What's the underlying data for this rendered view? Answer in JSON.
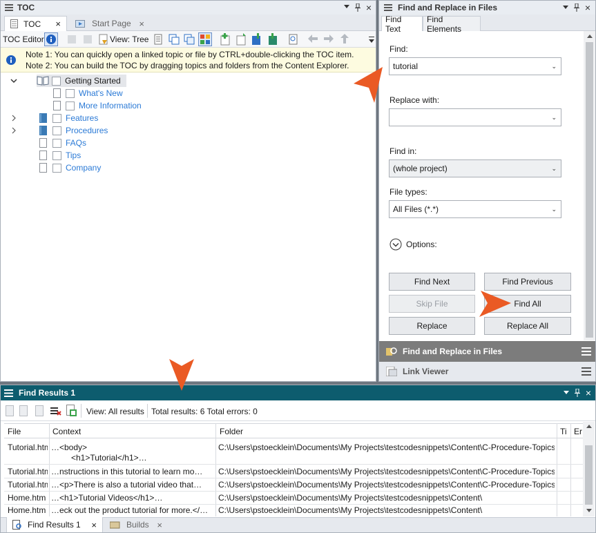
{
  "toc_pane": {
    "title": "TOC",
    "tabs": [
      {
        "label": "TOC"
      },
      {
        "label": "Start Page"
      }
    ],
    "toolbar": {
      "editor_label": "TOC Editor",
      "view_label": "View: Tree"
    },
    "notes": [
      "Note 1: You can quickly open a linked topic or file by CTRL+double-clicking the TOC item.",
      "Note 2: You can build the TOC by dragging topics and folders from the Content Explorer."
    ],
    "tree": [
      {
        "label": "Getting Started"
      },
      {
        "label": "What's New"
      },
      {
        "label": "More Information"
      },
      {
        "label": "Features"
      },
      {
        "label": "Procedures"
      },
      {
        "label": "FAQs"
      },
      {
        "label": "Tips"
      },
      {
        "label": "Company"
      }
    ]
  },
  "find_pane": {
    "title": "Find and Replace in Files",
    "tabs": [
      {
        "label": "Find Text"
      },
      {
        "label": "Find Elements"
      }
    ],
    "find_label": "Find:",
    "find_value": "tutorial",
    "replace_label": "Replace with:",
    "replace_value": "",
    "find_in_label": "Find in:",
    "find_in_value": "(whole project)",
    "file_types_label": "File types:",
    "file_types_value": "All Files (*.*)",
    "options_label": "Options:",
    "buttons": {
      "find_next": "Find Next",
      "find_previous": "Find Previous",
      "skip_file": "Skip File",
      "find_all": "Find All",
      "replace": "Replace",
      "replace_all": "Replace All"
    },
    "collapsed_panels": [
      {
        "label": "Find and Replace in Files"
      },
      {
        "label": "Link Viewer"
      }
    ]
  },
  "results_pane": {
    "title": "Find Results 1",
    "view_label": "View: All results",
    "summary": "Total results: 6 Total errors: 0",
    "columns": [
      "File",
      "Context",
      "Folder",
      "Ti",
      "Er"
    ],
    "rows": [
      {
        "file": "Tutorial.htm",
        "context": "…<body>",
        "context2": "<h1>Tutorial</h1>…",
        "folder": "C:\\Users\\pstoecklein\\Documents\\My Projects\\testcodesnippets\\Content\\C-Procedure-Topics"
      },
      {
        "file": "Tutorial.htm",
        "context": "…nstructions in this tutorial to learn mo…",
        "folder": "C:\\Users\\pstoecklein\\Documents\\My Projects\\testcodesnippets\\Content\\C-Procedure-Topics"
      },
      {
        "file": "Tutorial.htm",
        "context": "…<p>There is also a tutorial video that…",
        "folder": "C:\\Users\\pstoecklein\\Documents\\My Projects\\testcodesnippets\\Content\\C-Procedure-Topics"
      },
      {
        "file": "Home.htm",
        "context": "…<h1>Tutorial Videos</h1>…",
        "folder": "C:\\Users\\pstoecklein\\Documents\\My Projects\\testcodesnippets\\Content\\"
      },
      {
        "file": "Home.htm",
        "context": "…eck out the product tutorial for more.</…",
        "folder": "C:\\Users\\pstoecklein\\Documents\\My Projects\\testcodesnippets\\Content\\"
      }
    ],
    "bottom_tabs": [
      {
        "label": "Find Results 1"
      },
      {
        "label": "Builds"
      }
    ]
  },
  "colors": {
    "accent_dark": "#0d5c6e",
    "link_blue": "#2b7ad6",
    "callout_arrow": "#ea5a24",
    "note_bg": "#fdfbe0"
  }
}
